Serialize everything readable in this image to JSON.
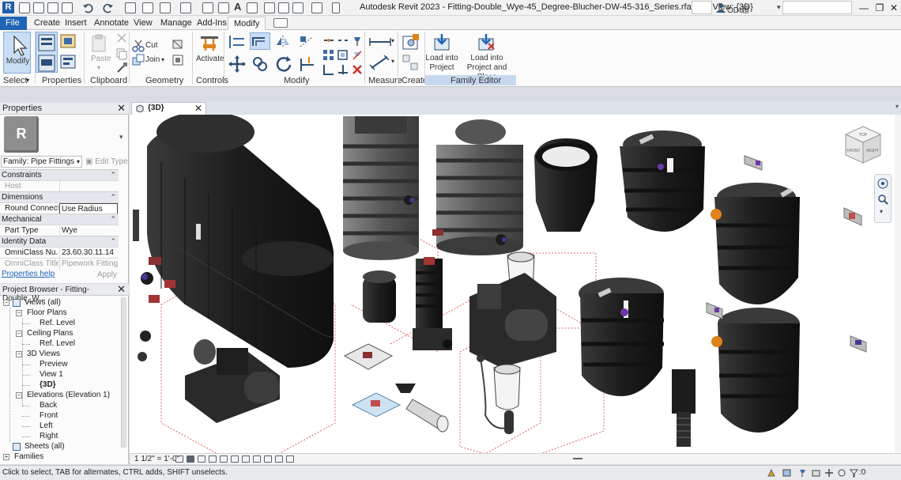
{
  "titlebar": {
    "app_letter": "R",
    "document_title": "Autodesk Revit 2023 - Fitting-Double_Wye-45_Degree-Blucher-DW-45-316_Series.rfa - 3D View: {3D}",
    "user_name": "ODI超",
    "window_buttons": {
      "minimize": "—",
      "restore": "❐",
      "close": "✕"
    }
  },
  "ribbon_tabs": [
    "File",
    "Create",
    "Insert",
    "Annotate",
    "View",
    "Manage",
    "Add-Ins",
    "Modify"
  ],
  "ribbon": {
    "modify_button": "Modify",
    "select_label": "Select",
    "properties_label": "Properties",
    "paste_label": "Paste",
    "cut_label": "Cut",
    "join_label": "Join",
    "clipboard_label": "Clipboard",
    "geometry_label": "Geometry",
    "activate_label": "Activate",
    "controls_label": "Controls",
    "modify_label": "Modify",
    "measure_label": "Measure",
    "create_label": "Create",
    "load_into_project": "Load into\nProject",
    "load_into_project_close": "Load into\nProject and Close",
    "family_editor_label": "Family Editor"
  },
  "properties": {
    "title": "Properties",
    "close": "✕",
    "type_letter": "R",
    "family_selector": "Family: Pipe Fittings",
    "edit_type": "Edit Type",
    "groups": [
      {
        "name": "Constraints",
        "rows": [
          {
            "key": "Host",
            "value": "",
            "dim": true
          }
        ]
      },
      {
        "name": "Dimensions",
        "rows": [
          {
            "key": "Round Connect...",
            "value": "Use Radius",
            "edit": true
          }
        ]
      },
      {
        "name": "Mechanical",
        "rows": [
          {
            "key": "Part Type",
            "value": "Wye"
          }
        ]
      },
      {
        "name": "Identity Data",
        "rows": [
          {
            "key": "OmniClass Nu...",
            "value": "23.60.30.11.14"
          },
          {
            "key": "OmniClass Title",
            "value": "Pipework Fittings",
            "dim": true
          }
        ]
      }
    ],
    "help_link": "Properties help",
    "apply": "Apply"
  },
  "project_browser": {
    "title": "Project Browser - Fitting-Double_W...",
    "close": "✕",
    "items": [
      {
        "label": "Views (all)",
        "level": 0,
        "toggle": "−",
        "icon": true
      },
      {
        "label": "Floor Plans",
        "level": 1,
        "toggle": "−"
      },
      {
        "label": "Ref. Level",
        "level": 2
      },
      {
        "label": "Ceiling Plans",
        "level": 1,
        "toggle": "−"
      },
      {
        "label": "Ref. Level",
        "level": 2
      },
      {
        "label": "3D Views",
        "level": 1,
        "toggle": "−"
      },
      {
        "label": "Preview",
        "level": 2
      },
      {
        "label": "View 1",
        "level": 2
      },
      {
        "label": "{3D}",
        "level": 2,
        "bold": true
      },
      {
        "label": "Elevations (Elevation 1)",
        "level": 1,
        "toggle": "−"
      },
      {
        "label": "Back",
        "level": 2
      },
      {
        "label": "Front",
        "level": 2
      },
      {
        "label": "Left",
        "level": 2
      },
      {
        "label": "Right",
        "level": 2
      },
      {
        "label": "Sheets (all)",
        "level": 0,
        "icon": true
      },
      {
        "label": "Families",
        "level": 0,
        "toggle": "+"
      }
    ]
  },
  "view": {
    "tab_label": "{3D}",
    "tab_close": "✕",
    "scale": "1 1/2\" = 1'-0\"",
    "viewcube_faces": {
      "top": "TOP",
      "front": "FRONT",
      "right": "RIGHT"
    }
  },
  "status": {
    "text": "Click to select, TAB for alternates, CTRL adds, SHIFT unselects.",
    "filter_count": ":0"
  },
  "colors": {
    "file_tab": "#1f64b5",
    "accent_orange": "#e0821a",
    "link_blue": "#1d63b8",
    "hidden_line_red": "#d6403d"
  }
}
